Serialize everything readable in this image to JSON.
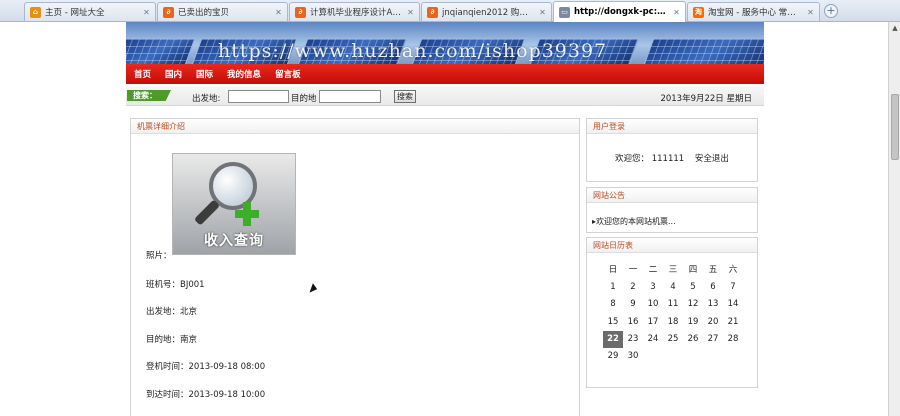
{
  "tabs": [
    {
      "label": "主页 - 网址大全",
      "icon": "home-icon",
      "icon_color": "#e78f10",
      "active": false
    },
    {
      "label": "已卖出的宝贝",
      "icon": "page-icon",
      "icon_color": "#e8661c",
      "active": false
    },
    {
      "label": "计算机毕业程序设计ASP....",
      "icon": "page-icon",
      "icon_color": "#e8661c",
      "active": false
    },
    {
      "label": "jnqianqien2012 购买心...",
      "icon": "page-icon",
      "icon_color": "#e8661c",
      "active": false
    },
    {
      "label": "http://dongxk-pc:808...",
      "icon": "page-icon",
      "icon_color": "#7a8aa0",
      "active": true
    },
    {
      "label": "淘宝网 - 服务中心 常见...",
      "icon": "taobao-icon",
      "icon_color": "#ff6a00",
      "active": false
    }
  ],
  "new_tab_glyph": "+",
  "banner": {
    "watermark": "https://www.huzhan.com/ishop39397"
  },
  "nav": {
    "items": [
      "首页",
      "国内",
      "国际",
      "我的信息",
      "留言板"
    ]
  },
  "search": {
    "tag": "搜索：",
    "from_label": "出发地:",
    "to_label": "目的地",
    "from_value": "",
    "to_value": "",
    "button": "搜索",
    "date": "2013年9月22日 星期日"
  },
  "detail": {
    "title": "机票详细介绍",
    "photo_caption": "收入查询",
    "fields": [
      {
        "label": "照片：",
        "value": ""
      },
      {
        "label": "班机号：",
        "value": "BJ001"
      },
      {
        "label": "出发地：",
        "value": "北京"
      },
      {
        "label": "目的地：",
        "value": "南京"
      },
      {
        "label": "登机时间：",
        "value": "2013-09-18 08:00"
      },
      {
        "label": "到达时间：",
        "value": "2013-09-18 10:00"
      }
    ]
  },
  "login": {
    "title": "用户登录",
    "welcome": "欢迎您：",
    "username": "111111",
    "logout": "安全退出"
  },
  "notice": {
    "title": "网站公告",
    "items": [
      "▸欢迎您的本网站机票..."
    ]
  },
  "calendar": {
    "title": "网站日历表",
    "weekdays": [
      "日",
      "一",
      "二",
      "三",
      "四",
      "五",
      "六"
    ],
    "weeks": [
      [
        "1",
        "2",
        "3",
        "4",
        "5",
        "6",
        "7"
      ],
      [
        "8",
        "9",
        "10",
        "11",
        "12",
        "13",
        "14"
      ],
      [
        "15",
        "16",
        "17",
        "18",
        "19",
        "20",
        "21"
      ],
      [
        "22",
        "23",
        "24",
        "25",
        "26",
        "27",
        "28"
      ],
      [
        "29",
        "30",
        "",
        "",
        "",
        "",
        ""
      ]
    ],
    "selected": "22"
  },
  "colors": {
    "nav_red": "#d4160f",
    "search_green": "#4e9a2a",
    "box_title": "#c24a1e"
  }
}
